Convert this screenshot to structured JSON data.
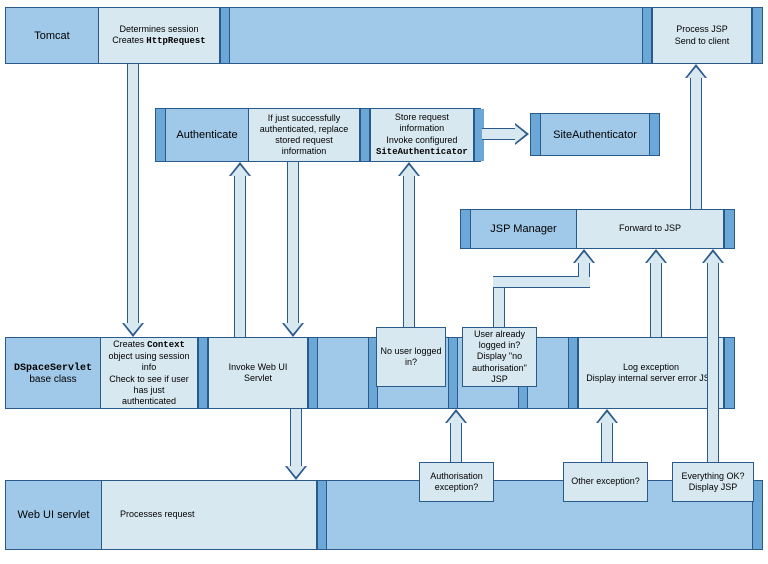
{
  "tomcat": {
    "label": "Tomcat",
    "box1_l1": "Determines session",
    "box1_l2": "Creates ",
    "box1_code": "HttpRequest",
    "box2_l1": "Process JSP",
    "box2_l2": "Send to client"
  },
  "auth": {
    "label": "Authenticate",
    "box1": "If just successfully authenticated, replace stored request information",
    "box2_l1": "Store request information",
    "box2_l2": "Invoke configured",
    "box2_code": "SiteAuthenticator",
    "site": "SiteAuthenticator"
  },
  "jsp": {
    "label": "JSP Manager",
    "box1": "Forward to JSP"
  },
  "dspace": {
    "label_l1": "DSpaceServlet",
    "label_l2": "base class",
    "box1_l1": "Creates ",
    "box1_code": "Context",
    "box1_l2": " object using session info",
    "box1_l3": "Check to see if user has just authenticated",
    "box2": "Invoke Web UI Servlet",
    "box3": "No user logged in?",
    "box4": "User already logged in? Display \"no authorisation\" JSP",
    "box5_l1": "Log exception",
    "box5_l2": "Display internal server error JSP"
  },
  "webui": {
    "label": "Web UI servlet",
    "box1": "Processes request",
    "box2": "Authorisation exception?",
    "box3": "Other exception?",
    "box4_l1": "Everything OK?",
    "box4_l2": "Display JSP"
  }
}
